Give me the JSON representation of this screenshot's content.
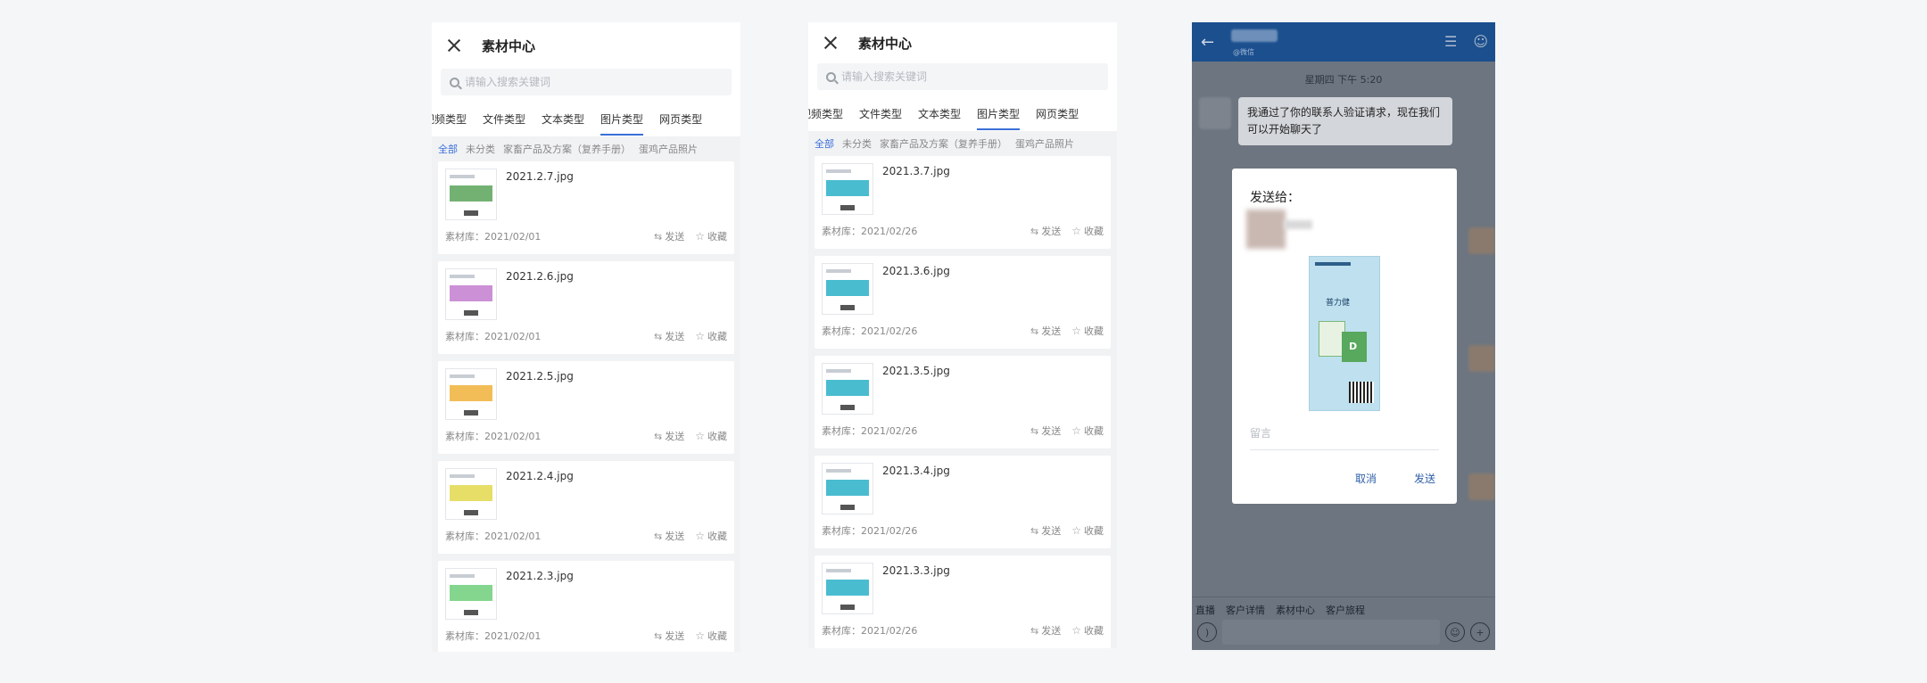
{
  "header": {
    "title": "素材中心"
  },
  "search": {
    "placeholder": "请输入搜索关键词"
  },
  "tabs_p1": [
    "视频类型",
    "文件类型",
    "文本类型",
    "图片类型",
    "网页类型"
  ],
  "tabs_p2": [
    "视频类型",
    "文件类型",
    "文本类型",
    "图片类型",
    "网页类型"
  ],
  "subtabs": [
    "全部",
    "未分类",
    "家畜产品及方案（复养手册）",
    "蛋鸡产品照片"
  ],
  "actions": {
    "send": "发送",
    "favorite": "收藏"
  },
  "list_p1": [
    {
      "name": "2021.2.7.jpg",
      "lib": "素材库：2021/02/01",
      "accent": "#5aa35a"
    },
    {
      "name": "2021.2.6.jpg",
      "lib": "素材库：2021/02/01",
      "accent": "#c27ccf"
    },
    {
      "name": "2021.2.5.jpg",
      "lib": "素材库：2021/02/01",
      "accent": "#f0b23a"
    },
    {
      "name": "2021.2.4.jpg",
      "lib": "素材库：2021/02/01",
      "accent": "#e3d84e"
    },
    {
      "name": "2021.2.3.jpg",
      "lib": "素材库：2021/02/01",
      "accent": "#6fcf7a"
    }
  ],
  "list_p2": [
    {
      "name": "2021.3.7.jpg",
      "lib": "素材库：2021/02/26",
      "accent": "#2ab0c8"
    },
    {
      "name": "2021.3.6.jpg",
      "lib": "素材库：2021/02/26",
      "accent": "#2ab0c8"
    },
    {
      "name": "2021.3.5.jpg",
      "lib": "素材库：2021/02/26",
      "accent": "#2ab0c8"
    },
    {
      "name": "2021.3.4.jpg",
      "lib": "素材库：2021/02/26",
      "accent": "#2ab0c8"
    },
    {
      "name": "2021.3.3.jpg",
      "lib": "素材库：2021/02/26",
      "accent": "#2ab0c8"
    }
  ],
  "chat": {
    "contact_sub": "@微信",
    "time": "星期四 下午 5:20",
    "message": "我通过了你的联系人验证请求，现在我们可以开始聊天了",
    "toolbar": [
      "直播",
      "客户详情",
      "素材中心",
      "客户旅程"
    ],
    "dialog": {
      "title": "发送给：",
      "poster_heading": "普力健",
      "message_placeholder": "留言",
      "cancel": "取消",
      "send": "发送"
    }
  }
}
